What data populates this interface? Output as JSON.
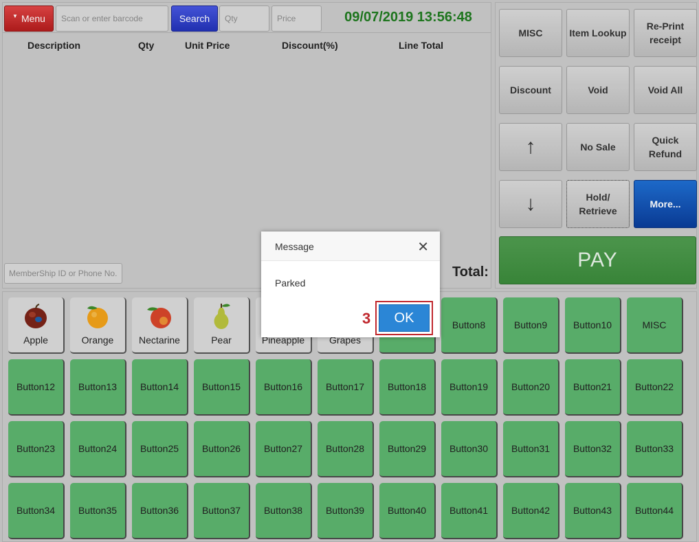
{
  "topbar": {
    "menu_label": "Menu",
    "barcode_placeholder": "Scan or enter barcode",
    "search_label": "Search",
    "qty_placeholder": "Qty",
    "price_placeholder": "Price",
    "datetime": "09/07/2019 13:56:48"
  },
  "table": {
    "columns": [
      "Description",
      "Qty",
      "Unit Price",
      "Discount(%)",
      "Line Total"
    ]
  },
  "membership_placeholder": "MemberShip ID or Phone No.",
  "total_label": "Total:",
  "functions": [
    {
      "label": "MISC"
    },
    {
      "label": "Item Lookup"
    },
    {
      "label": "Re-Print receipt"
    },
    {
      "label": "Discount"
    },
    {
      "label": "Void"
    },
    {
      "label": "Void All"
    },
    {
      "label": "↑",
      "icon": "up-arrow-icon"
    },
    {
      "label": "No Sale"
    },
    {
      "label": "Quick Refund"
    },
    {
      "label": "↓",
      "icon": "down-arrow-icon"
    },
    {
      "label": "Hold/ Retrieve"
    },
    {
      "label": "More..."
    }
  ],
  "pay_label": "PAY",
  "products": [
    {
      "label": "Apple",
      "icon": "apple-icon"
    },
    {
      "label": "Orange",
      "icon": "orange-icon"
    },
    {
      "label": "Nectarine",
      "icon": "nectarine-icon"
    },
    {
      "label": "Pear",
      "icon": "pear-icon"
    },
    {
      "label": "Pineapple",
      "icon": "pineapple-icon"
    },
    {
      "label": "Grapes",
      "icon": "grapes-icon"
    }
  ],
  "grid_row1": [
    "Button8",
    "Button9",
    "Button10",
    "MISC"
  ],
  "grid_row2": [
    "Button12",
    "Button13",
    "Button14",
    "Button15",
    "Button16",
    "Button17",
    "Button18",
    "Button19",
    "Button20",
    "Button21",
    "Button22"
  ],
  "grid_row3": [
    "Button23",
    "Button24",
    "Button25",
    "Button26",
    "Button27",
    "Button28",
    "Button29",
    "Button30",
    "Button31",
    "Button32",
    "Button33"
  ],
  "grid_row4": [
    "Button34",
    "Button35",
    "Button36",
    "Button37",
    "Button38",
    "Button39",
    "Button40",
    "Button41",
    "Button42",
    "Button43",
    "Button44"
  ],
  "dialog": {
    "title": "Message",
    "message": "Parked",
    "ok_label": "OK",
    "step_number": "3"
  },
  "colors": {
    "menu": "#c62828",
    "search": "#2d3fc7",
    "clock": "#1f7a1f",
    "pay": "#459545",
    "grid_button": "#5cb36e",
    "more": "#0a4fb5",
    "ok": "#2b86d6",
    "highlight": "#c0272d"
  }
}
